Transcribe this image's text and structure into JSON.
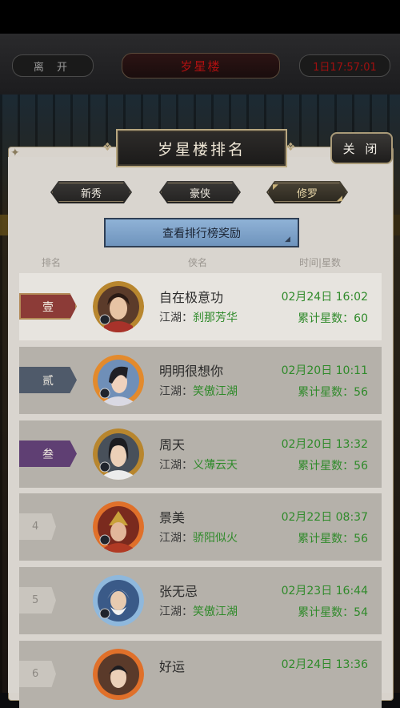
{
  "hud": {
    "leave_label": "离 开",
    "title": "岁星楼",
    "timer": "1日17:57:01"
  },
  "panel": {
    "title": "岁星楼排名",
    "close_label": "关 闭"
  },
  "tabs": [
    {
      "label": "新秀"
    },
    {
      "label": "豪侠"
    },
    {
      "label": "修罗",
      "selected": true
    }
  ],
  "reward_button": "查看排行榜奖励",
  "columns": {
    "rank": "排名",
    "player": "侠名",
    "time": "时间|星数"
  },
  "labels": {
    "sect_prefix": "江湖：",
    "stars_prefix": "累计星数："
  },
  "rows": [
    {
      "rank": "壹",
      "name": "自在极意功",
      "sect": "刹那芳华",
      "time": "02月24日 16:02",
      "stars": "60",
      "avatar": "hero-avatar-gold-frame"
    },
    {
      "rank": "贰",
      "name": "明明很想你",
      "sect": "笑傲江湖",
      "time": "02月20日 10:11",
      "stars": "56",
      "avatar": "hero-avatar-flame-frame"
    },
    {
      "rank": "叁",
      "name": "周天",
      "sect": "义薄云天",
      "time": "02月20日 13:32",
      "stars": "56",
      "avatar": "hero-avatar-gold-frame"
    },
    {
      "rank": "4",
      "name": "景美",
      "sect": "骄阳似火",
      "time": "02月22日 08:37",
      "stars": "56",
      "avatar": "hero-avatar-flame-frame"
    },
    {
      "rank": "5",
      "name": "张无忌",
      "sect": "笑傲江湖",
      "time": "02月23日 16:44",
      "stars": "54",
      "avatar": "hero-avatar-cloud-frame"
    },
    {
      "rank": "6",
      "name": "好运",
      "sect": "",
      "time": "02月24日 13:36",
      "stars": "",
      "avatar": "hero-avatar-flame-frame"
    }
  ],
  "colors": {
    "accent_green": "#2f8a2a",
    "rank1": "#8c3b37",
    "rank2": "#4f5a6a",
    "rank3": "#5f3f73",
    "button_blue": "#7fa3c9"
  }
}
